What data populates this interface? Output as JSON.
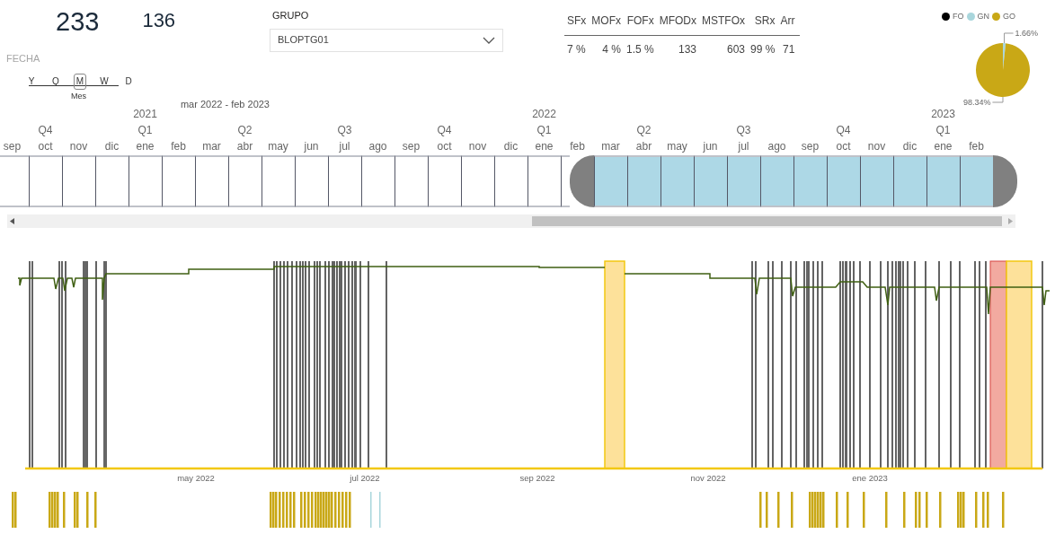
{
  "kpis": [
    {
      "value": "233"
    },
    {
      "value": "136"
    }
  ],
  "group_filter": {
    "label": "GRUPO",
    "value": "BLOPTG01"
  },
  "date_slicer": {
    "label": "FECHA",
    "levels": [
      {
        "label": "Y",
        "selected": false
      },
      {
        "label": "Q",
        "selected": false
      },
      {
        "label": "M",
        "selected": true
      },
      {
        "label": "W",
        "selected": false
      },
      {
        "label": "D",
        "selected": false
      }
    ],
    "selected_caption": "Mes",
    "range": "mar 2022 - feb 2023"
  },
  "metrics_table": {
    "columns": [
      "SFx",
      "MOFx",
      "FOFx",
      "MFODx",
      "MSTFOx",
      "SRx",
      "Arr"
    ],
    "rows": [
      [
        "7 %",
        "4 %",
        "1.5 %",
        "133",
        "603",
        "99 %",
        "71"
      ]
    ]
  },
  "fuel_pie": {
    "legend": [
      {
        "color": "#000000"
      },
      {
        "color": "#a9d6dc"
      },
      {
        "color": "#c9a816"
      }
    ],
    "chart_data": {
      "type": "pie",
      "categories": [
        "FO",
        "GN",
        "GO"
      ],
      "values": [
        null,
        1.66,
        98.34
      ],
      "value_labels": [
        null,
        "1.66%",
        "98.34%"
      ]
    }
  },
  "timeline": {
    "months": [
      {
        "label": "sep",
        "selected": false
      },
      {
        "label": "oct",
        "quarter": "Q4",
        "selected": false
      },
      {
        "label": "nov",
        "selected": false
      },
      {
        "label": "dic",
        "selected": false
      },
      {
        "label": "ene",
        "quarter": "Q1",
        "year": "2021",
        "selected": false
      },
      {
        "label": "feb",
        "selected": false
      },
      {
        "label": "mar",
        "selected": false
      },
      {
        "label": "abr",
        "quarter": "Q2",
        "selected": false
      },
      {
        "label": "may",
        "selected": false
      },
      {
        "label": "jun",
        "selected": false
      },
      {
        "label": "jul",
        "quarter": "Q3",
        "selected": false
      },
      {
        "label": "ago",
        "selected": false
      },
      {
        "label": "sep",
        "selected": false
      },
      {
        "label": "oct",
        "quarter": "Q4",
        "selected": false
      },
      {
        "label": "nov",
        "selected": false
      },
      {
        "label": "dic",
        "selected": false
      },
      {
        "label": "ene",
        "quarter": "Q1",
        "year": "2022",
        "selected": false
      },
      {
        "label": "feb",
        "selected": false
      },
      {
        "label": "mar",
        "selected": true
      },
      {
        "label": "abr",
        "quarter": "Q2",
        "selected": true
      },
      {
        "label": "may",
        "selected": true
      },
      {
        "label": "jun",
        "selected": true
      },
      {
        "label": "jul",
        "quarter": "Q3",
        "selected": true
      },
      {
        "label": "ago",
        "selected": true
      },
      {
        "label": "sep",
        "selected": true
      },
      {
        "label": "oct",
        "quarter": "Q4",
        "selected": true
      },
      {
        "label": "nov",
        "selected": true
      },
      {
        "label": "dic",
        "selected": true
      },
      {
        "label": "ene",
        "quarter": "Q1",
        "year": "2023",
        "selected": true
      },
      {
        "label": "feb",
        "selected": true
      }
    ]
  },
  "event_chart": {
    "x_labels": [
      "may 2022",
      "jul 2022",
      "sep 2022",
      "nov 2022",
      "ene 2023"
    ]
  }
}
